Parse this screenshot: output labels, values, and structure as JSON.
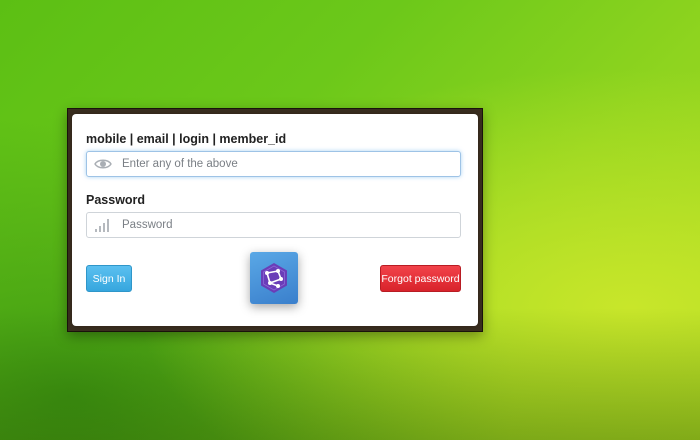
{
  "form": {
    "login_label": "mobile | email | login | member_id",
    "login_placeholder": "Enter any of the above",
    "login_value": "",
    "password_label": "Password",
    "password_placeholder": "Password",
    "password_value": ""
  },
  "buttons": {
    "signin_label": "Sign In",
    "forgot_label": "Forgot password"
  },
  "icons": {
    "login_field_icon": "eye-icon",
    "password_field_icon": "signal-bars-icon",
    "app_logo": "hexagon-network-icon"
  },
  "colors": {
    "signin_button": "#36a6de",
    "forgot_button": "#d8232b",
    "background_green": "#6cc81a",
    "logo_tile": "#3a7fcc",
    "logo_hex": "#6a3db8"
  }
}
